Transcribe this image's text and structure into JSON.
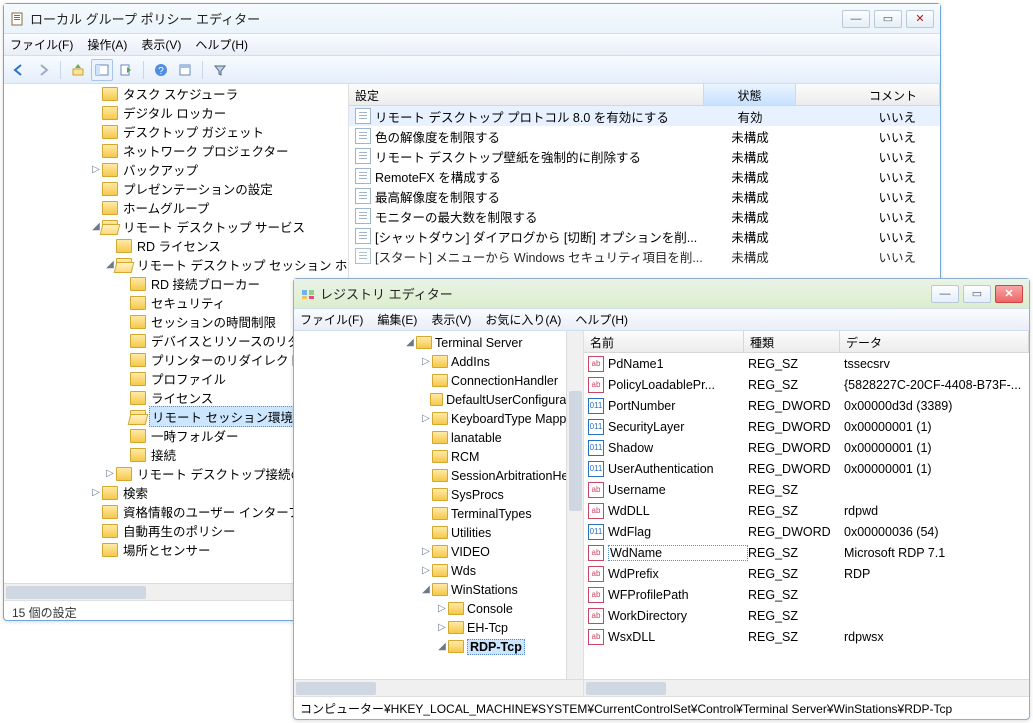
{
  "gpe": {
    "title": "ローカル グループ ポリシー エディター",
    "menu": {
      "file": "ファイル(F)",
      "action": "操作(A)",
      "view": "表示(V)",
      "help": "ヘルプ(H)"
    },
    "tree": [
      {
        "lvl": 1,
        "exp": "",
        "label": "タスク スケジューラ"
      },
      {
        "lvl": 1,
        "exp": "",
        "label": "デジタル ロッカー"
      },
      {
        "lvl": 1,
        "exp": "",
        "label": "デスクトップ ガジェット"
      },
      {
        "lvl": 1,
        "exp": "",
        "label": "ネットワーク プロジェクター"
      },
      {
        "lvl": 1,
        "exp": "▷",
        "label": "バックアップ"
      },
      {
        "lvl": 1,
        "exp": "",
        "label": "プレゼンテーションの設定"
      },
      {
        "lvl": 1,
        "exp": "",
        "label": "ホームグループ"
      },
      {
        "lvl": 1,
        "exp": "◢",
        "label": "リモート デスクトップ サービス",
        "open": true
      },
      {
        "lvl": 2,
        "exp": "",
        "label": "RD ライセンス"
      },
      {
        "lvl": 2,
        "exp": "◢",
        "label": "リモート デスクトップ セッション ホ...",
        "open": true
      },
      {
        "lvl": 3,
        "exp": "",
        "label": "RD 接続ブローカー"
      },
      {
        "lvl": 3,
        "exp": "",
        "label": "セキュリティ"
      },
      {
        "lvl": 3,
        "exp": "",
        "label": "セッションの時間制限"
      },
      {
        "lvl": 3,
        "exp": "",
        "label": "デバイスとリソースのリダ..."
      },
      {
        "lvl": 3,
        "exp": "",
        "label": "プリンターのリダイレクト"
      },
      {
        "lvl": 3,
        "exp": "",
        "label": "プロファイル"
      },
      {
        "lvl": 3,
        "exp": "",
        "label": "ライセンス"
      },
      {
        "lvl": 3,
        "exp": "",
        "label": "リモート セッション環境",
        "sel": true,
        "open": true
      },
      {
        "lvl": 3,
        "exp": "",
        "label": "一時フォルダー"
      },
      {
        "lvl": 3,
        "exp": "",
        "label": "接続"
      },
      {
        "lvl": 2,
        "exp": "▷",
        "label": "リモート デスクトップ接続の..."
      },
      {
        "lvl": 1,
        "exp": "▷",
        "label": "検索"
      },
      {
        "lvl": 1,
        "exp": "",
        "label": "資格情報のユーザー インターフェ..."
      },
      {
        "lvl": 1,
        "exp": "",
        "label": "自動再生のポリシー"
      },
      {
        "lvl": 1,
        "exp": "",
        "label": "場所とセンサー"
      }
    ],
    "listhdr": {
      "setting": "設定",
      "state": "状態",
      "comment": "コメント"
    },
    "rows": [
      {
        "label": "リモート デスクトップ プロトコル 8.0 を有効にする",
        "state": "有効",
        "cmt": "いいえ",
        "sel": true
      },
      {
        "label": "色の解像度を制限する",
        "state": "未構成",
        "cmt": "いいえ"
      },
      {
        "label": "リモート デスクトップ壁紙を強制的に削除する",
        "state": "未構成",
        "cmt": "いいえ"
      },
      {
        "label": "RemoteFX を構成する",
        "state": "未構成",
        "cmt": "いいえ"
      },
      {
        "label": "最高解像度を制限する",
        "state": "未構成",
        "cmt": "いいえ"
      },
      {
        "label": "モニターの最大数を制限する",
        "state": "未構成",
        "cmt": "いいえ"
      },
      {
        "label": "[シャットダウン] ダイアログから [切断] オプションを削...",
        "state": "未構成",
        "cmt": "いいえ"
      },
      {
        "label": "[スタート] メニューから Windows セキュリティ項目を削...",
        "state": "未構成",
        "cmt": "いいえ",
        "cut": true
      }
    ],
    "status": "15 個の設定"
  },
  "reg": {
    "title": "レジストリ エディター",
    "menu": {
      "file": "ファイル(F)",
      "edit": "編集(E)",
      "view": "表示(V)",
      "fav": "お気に入り(A)",
      "help": "ヘルプ(H)"
    },
    "tree": [
      {
        "lvl": 1,
        "exp": "◢",
        "label": "Terminal Server",
        "open": true
      },
      {
        "lvl": 2,
        "exp": "▷",
        "label": "AddIns"
      },
      {
        "lvl": 2,
        "exp": "",
        "label": "ConnectionHandler"
      },
      {
        "lvl": 2,
        "exp": "",
        "label": "DefaultUserConfigurati..."
      },
      {
        "lvl": 2,
        "exp": "▷",
        "label": "KeyboardType Mapp..."
      },
      {
        "lvl": 2,
        "exp": "",
        "label": "lanatable"
      },
      {
        "lvl": 2,
        "exp": "",
        "label": "RCM"
      },
      {
        "lvl": 2,
        "exp": "",
        "label": "SessionArbitrationHe..."
      },
      {
        "lvl": 2,
        "exp": "",
        "label": "SysProcs"
      },
      {
        "lvl": 2,
        "exp": "",
        "label": "TerminalTypes"
      },
      {
        "lvl": 2,
        "exp": "",
        "label": "Utilities"
      },
      {
        "lvl": 2,
        "exp": "▷",
        "label": "VIDEO"
      },
      {
        "lvl": 2,
        "exp": "▷",
        "label": "Wds"
      },
      {
        "lvl": 2,
        "exp": "◢",
        "label": "WinStations",
        "open": true
      },
      {
        "lvl": 3,
        "exp": "▷",
        "label": "Console"
      },
      {
        "lvl": 3,
        "exp": "▷",
        "label": "EH-Tcp"
      },
      {
        "lvl": 3,
        "exp": "◢",
        "label": "RDP-Tcp",
        "sel": true
      }
    ],
    "valhdr": {
      "name": "名前",
      "type": "種類",
      "data": "データ"
    },
    "vals": [
      {
        "name": "PdName1",
        "type": "REG_SZ",
        "data": "tssecsrv",
        "k": "sz"
      },
      {
        "name": "PolicyLoadablePr...",
        "type": "REG_SZ",
        "data": "{5828227C-20CF-4408-B73F-...",
        "k": "sz"
      },
      {
        "name": "PortNumber",
        "type": "REG_DWORD",
        "data": "0x00000d3d (3389)",
        "k": "dw"
      },
      {
        "name": "SecurityLayer",
        "type": "REG_DWORD",
        "data": "0x00000001 (1)",
        "k": "dw"
      },
      {
        "name": "Shadow",
        "type": "REG_DWORD",
        "data": "0x00000001 (1)",
        "k": "dw"
      },
      {
        "name": "UserAuthentication",
        "type": "REG_DWORD",
        "data": "0x00000001 (1)",
        "k": "dw"
      },
      {
        "name": "Username",
        "type": "REG_SZ",
        "data": "",
        "k": "sz"
      },
      {
        "name": "WdDLL",
        "type": "REG_SZ",
        "data": "rdpwd",
        "k": "sz"
      },
      {
        "name": "WdFlag",
        "type": "REG_DWORD",
        "data": "0x00000036 (54)",
        "k": "dw"
      },
      {
        "name": "WdName",
        "type": "REG_SZ",
        "data": "Microsoft RDP 7.1",
        "k": "sz",
        "sel": true
      },
      {
        "name": "WdPrefix",
        "type": "REG_SZ",
        "data": "RDP",
        "k": "sz"
      },
      {
        "name": "WFProfilePath",
        "type": "REG_SZ",
        "data": "",
        "k": "sz"
      },
      {
        "name": "WorkDirectory",
        "type": "REG_SZ",
        "data": "",
        "k": "sz"
      },
      {
        "name": "WsxDLL",
        "type": "REG_SZ",
        "data": "rdpwsx",
        "k": "sz"
      }
    ],
    "status": "コンピューター¥HKEY_LOCAL_MACHINE¥SYSTEM¥CurrentControlSet¥Control¥Terminal Server¥WinStations¥RDP-Tcp"
  }
}
